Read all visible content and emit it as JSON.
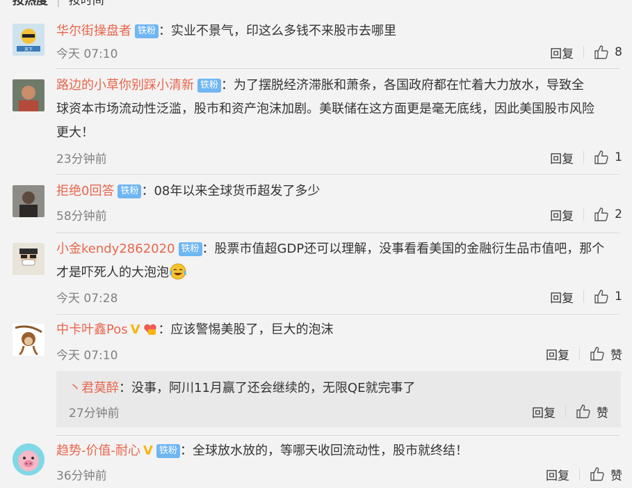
{
  "sort": {
    "hot": "按热度",
    "time": "按时间"
  },
  "badge_label": "铁粉",
  "reply_label": "回复",
  "comments": [
    {
      "user": "华尔街操盘者",
      "badge": true,
      "text": "实业不景气，印这么多钱不来股市去哪里",
      "time": "今天 07:10",
      "likes": "8"
    },
    {
      "user": "路边的小草你别踩小清新",
      "badge": true,
      "text_line1": "为了摆脱经济滞胀和萧条，各国政府都在忙着大力放水，导致全",
      "text_line2": "球资本市场流动性泛滥，股市和资产泡沫加剧。美联储在这方面更是毫无底线，因此美国股市风险",
      "text_line3": "更大！",
      "time": "23分钟前",
      "likes": "1"
    },
    {
      "user": "拒绝0回答",
      "badge": true,
      "text": "08年以来全球货币超发了多少",
      "time": "58分钟前",
      "likes": "2"
    },
    {
      "user": "小金kendy2862020",
      "badge": true,
      "text_line1": "股票市值超GDP还可以理解，没事看看美国的金融衍生品市值吧，那个",
      "text_line2": "才是吓死人的大泡泡",
      "time": "今天 07:28",
      "likes": "1"
    },
    {
      "user": "中卡叶鑫Pos",
      "vip": "V",
      "text": "应该警惕美股了，巨大的泡沫",
      "time": "今天 07:10",
      "likes": "赞",
      "reply": {
        "arrow": "丶",
        "user": "君莫醉",
        "text": "没事，阿川11月赢了还会继续的，无限QE就完事了",
        "time": "27分钟前",
        "likes": "赞"
      }
    },
    {
      "user": "趋势-价值-耐心",
      "vip": "V",
      "badge": true,
      "text": "全球放水放的，等哪天收回流动性，股市就终结！",
      "time": "36分钟前",
      "likes": "赞"
    }
  ],
  "colors": {
    "name": "#e8664d",
    "badge": "#6fb6f2",
    "vip": "#f7b514",
    "background": "#f3f3f3"
  }
}
